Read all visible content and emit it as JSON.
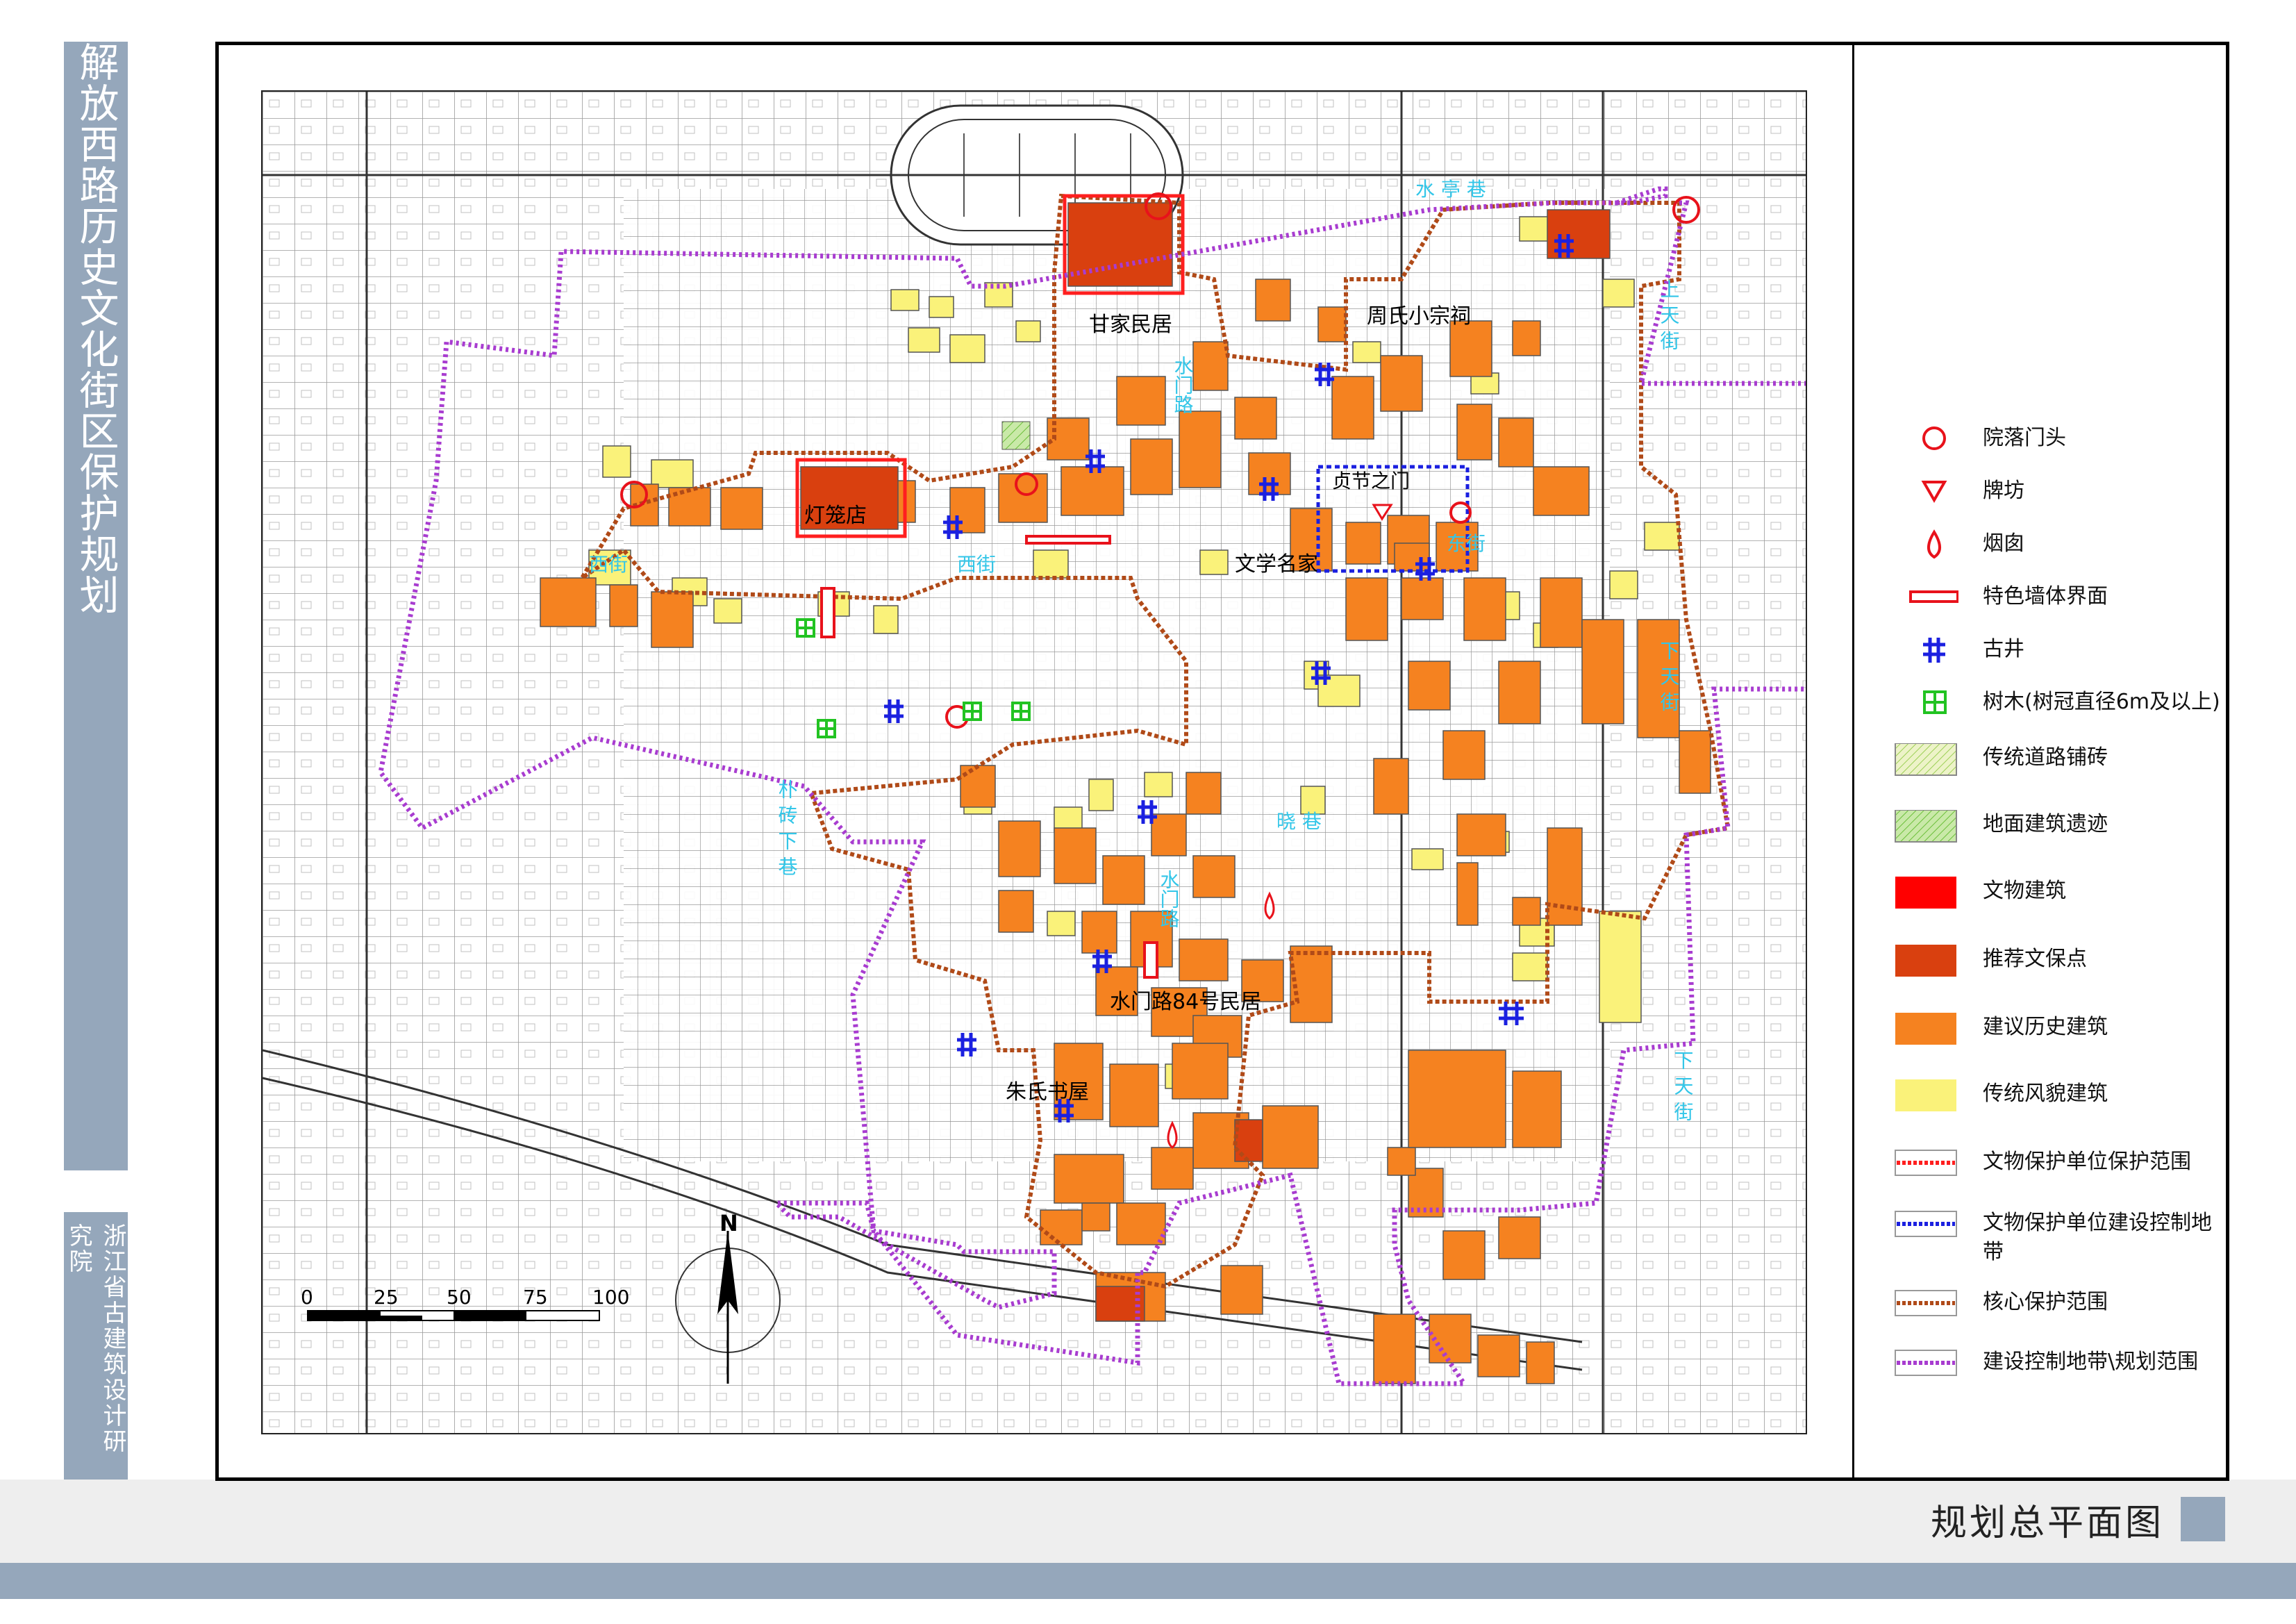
{
  "side_title": "解放西路历史文化街区保护规划",
  "org_name": "浙江省古建筑设计研究院",
  "sheet_title": "规划总平面图",
  "colors": {
    "band": "#95a7bb",
    "recommended_heritage": "#d9400f",
    "proposed_historic": "#f58220",
    "traditional_style": "#faf27a",
    "heritage_building": "#ff0000",
    "well_blue": "#1b20e0",
    "tree_green": "#22c322",
    "core_boundary": "#b04a18",
    "control_boundary": "#a83cd0",
    "street_label": "#33c6e8"
  },
  "map_labels": {
    "ganjia": "甘家民居",
    "zhoushi": "周氏小宗祠",
    "denglong": "灯笼店",
    "zhenjie": "贞节之门",
    "wenxue": "文学名家",
    "shuimen84": "水门路84号民居",
    "zhushi": "朱氏书屋"
  },
  "street_labels": {
    "shuiting_xiang": "水 亭 巷",
    "shang_tian_jie": "上 天 街",
    "xia_tian_jie": "下 天 街",
    "xia_tian_jie2": "下 天 街",
    "puzhuan_xia_xiang": "朴 砖 下 巷",
    "shuimen_lu": "水门路",
    "shuimen_lu2": "水门路",
    "xi_jie": "西街",
    "xi_jie2": "西街",
    "dong_jie": "东街",
    "xiao_xiang": "晓 巷"
  },
  "scale_bar": {
    "ticks": [
      "0",
      "25",
      "50",
      "75",
      "100"
    ],
    "north": "N"
  },
  "legend": [
    {
      "icon": "circle-red-icon",
      "label": "院落门头"
    },
    {
      "icon": "triangle-red-icon",
      "label": "牌坊"
    },
    {
      "icon": "drop-red-icon",
      "label": "烟囱"
    },
    {
      "icon": "rect-red-outline-icon",
      "label": "特色墙体界面"
    },
    {
      "icon": "hash-blue-icon",
      "label": "古井"
    },
    {
      "icon": "tree-green-icon",
      "label": "树木(树冠直径6m及以上)"
    },
    {
      "icon": "hatch-yellowgreen-swatch",
      "label": "传统道路铺砖"
    },
    {
      "icon": "hatch-green-swatch",
      "label": "地面建筑遗迹"
    },
    {
      "icon": "red-swatch",
      "label": "文物建筑"
    },
    {
      "icon": "darkorange-swatch",
      "label": "推荐文保点"
    },
    {
      "icon": "orange-swatch",
      "label": "建议历史建筑"
    },
    {
      "icon": "yellow-swatch",
      "label": "传统风貌建筑"
    },
    {
      "icon": "red-dashed-line-icon",
      "label": "文物保护单位保护范围"
    },
    {
      "icon": "blue-dashed-line-icon",
      "label": "文物保护单位建设控制地带"
    },
    {
      "icon": "brown-dashed-line-icon",
      "label": "核心保护范围"
    },
    {
      "icon": "purple-dashed-line-icon",
      "label": "建设控制地带\\规划范围"
    }
  ]
}
